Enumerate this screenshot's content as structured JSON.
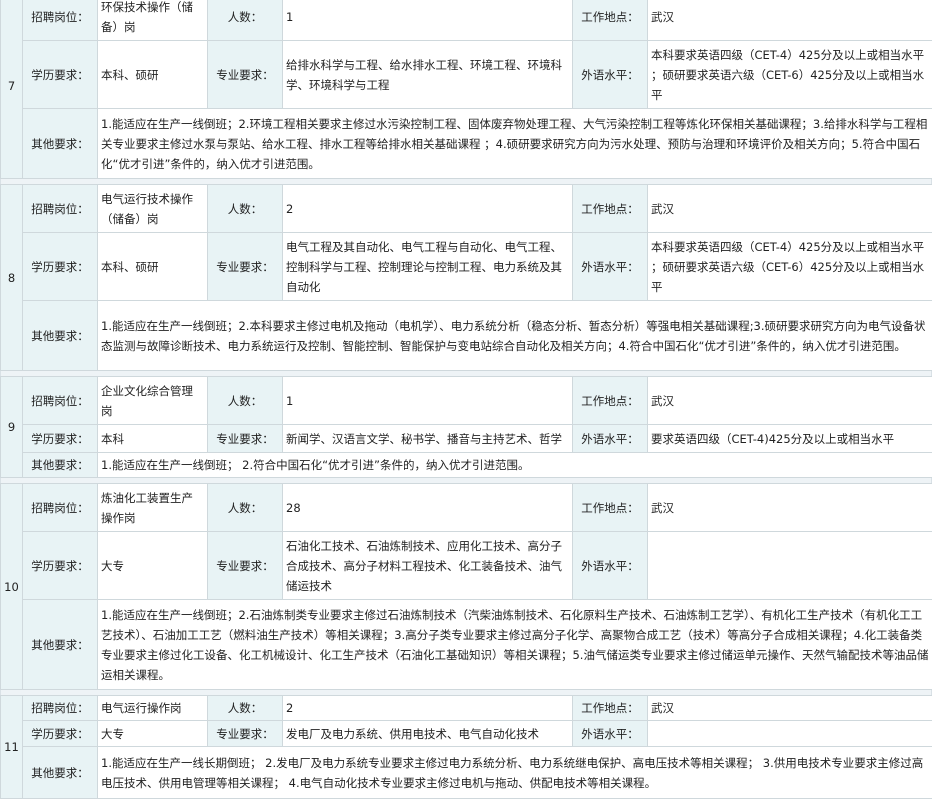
{
  "labels": {
    "post": "招聘岗位：",
    "count": "人数：",
    "location": "工作地点：",
    "education": "学历要求：",
    "major": "专业要求：",
    "language": "外语水平：",
    "other": "其他要求："
  },
  "jobs": [
    {
      "num": "7",
      "post": "环保技术操作（储备）岗",
      "count": "1",
      "location": "武汉",
      "education": "本科、硕研",
      "major": "给排水科学与工程、给水排水工程、环境工程、环境科学、环境科学与工程",
      "language": "本科要求英语四级（CET-4）425分及以上或相当水平 ；硕研要求英语六级（CET-6）425分及以上或相当水平",
      "other": "1.能适应在生产一线倒班；2.环境工程相关要求主修过水污染控制工程、固体废弃物处理工程、大气污染控制工程等炼化环保相关基础课程；3.给排水科学与工程相关专业要求主修过水泵与泵站、给水工程、排水工程等给排水相关基础课程 ；4.硕研要求研究方向为污水处理、预防与治理和环境评价及相关方向；5.符合中国石化“优才引进”条件的，纳入优才引进范围。"
    },
    {
      "num": "8",
      "post": "电气运行技术操作（储备）岗",
      "count": "2",
      "location": "武汉",
      "education": "本科、硕研",
      "major": "电气工程及其自动化、电气工程与自动化、电气工程、控制科学与工程、控制理论与控制工程、电力系统及其自动化",
      "language": "本科要求英语四级（CET-4）425分及以上或相当水平 ；硕研要求英语六级（CET-6）425分及以上或相当水平",
      "other": "1.能适应在生产一线倒班；2.本科要求主修过电机及拖动（电机学）、电力系统分析（稳态分析、暂态分析）等强电相关基础课程;3.硕研要求研究方向为电气设备状态监测与故障诊断技术、电力系统运行及控制、智能控制、智能保护与变电站综合自动化及相关方向；4.符合中国石化“优才引进”条件的，纳入优才引进范围。"
    },
    {
      "num": "9",
      "post": "企业文化综合管理岗",
      "count": "1",
      "location": "武汉",
      "education": "本科",
      "major": "新闻学、汉语言文学、秘书学、播音与主持艺术、哲学",
      "language": "要求英语四级（CET-4)425分及以上或相当水平",
      "other": "1.能适应在生产一线倒班； 2.符合中国石化“优才引进”条件的，纳入优才引进范围。"
    },
    {
      "num": "10",
      "post": "炼油化工装置生产操作岗",
      "count": "28",
      "location": "武汉",
      "education": "大专",
      "major": "石油化工技术、石油炼制技术、应用化工技术、高分子合成技术、高分子材料工程技术、化工装备技术、油气储运技术",
      "language": "",
      "other": "1.能适应在生产一线倒班；2.石油炼制类专业要求主修过石油炼制技术（汽柴油炼制技术、石化原料生产技术、石油炼制工艺学）、有机化工生产技术（有机化工工艺技术）、石油加工工艺（燃料油生产技术）等相关课程；3.高分子类专业要求主修过高分子化学、高聚物合成工艺（技术）等高分子合成相关课程；4.化工装备类专业要求主修过化工设备、化工机械设计、化工生产技术（石油化工基础知识）等相关课程；5.油气储运类专业要求主修过储运单元操作、天然气输配技术等油品储运相关课程。"
    },
    {
      "num": "11",
      "post": "电气运行操作岗",
      "count": "2",
      "location": "武汉",
      "education": "大专",
      "major": "发电厂及电力系统、供用电技术、电气自动化技术",
      "language": "",
      "other": "1.能适应在生产一线长期倒班； 2.发电厂及电力系统专业要求主修过电力系统分析、电力系统继电保护、高电压技术等相关课程； 3.供用电技术专业要求主修过高电压技术、供用电管理等相关课程； 4.电气自动化技术专业要求主修过电机与拖动、供配电技术等相关课程。"
    }
  ]
}
